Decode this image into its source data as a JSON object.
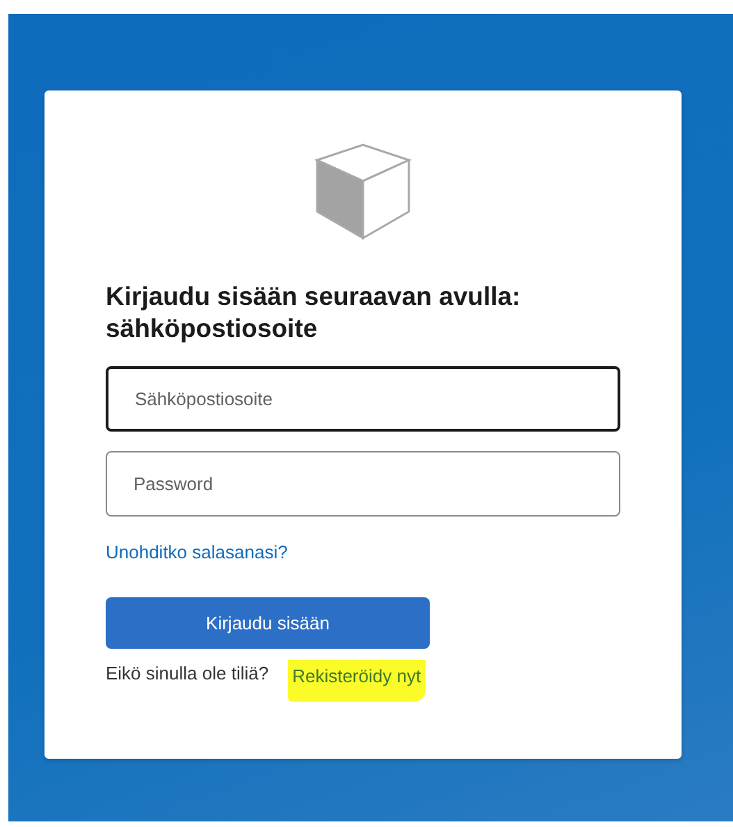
{
  "heading": "Kirjaudu sisään seuraavan avulla: sähköpostiosoite",
  "fields": [
    {
      "placeholder": "Sähköpostiosoite",
      "focused": true
    },
    {
      "placeholder": "Password",
      "focused": false
    }
  ],
  "forgot_link": "Unohditko salasanasi?",
  "submit_button": "Kirjaudu sisään",
  "signup": {
    "prompt": "Eikö sinulla ole tiliä?",
    "link": "Rekisteröidy nyt",
    "highlighted": true
  }
}
